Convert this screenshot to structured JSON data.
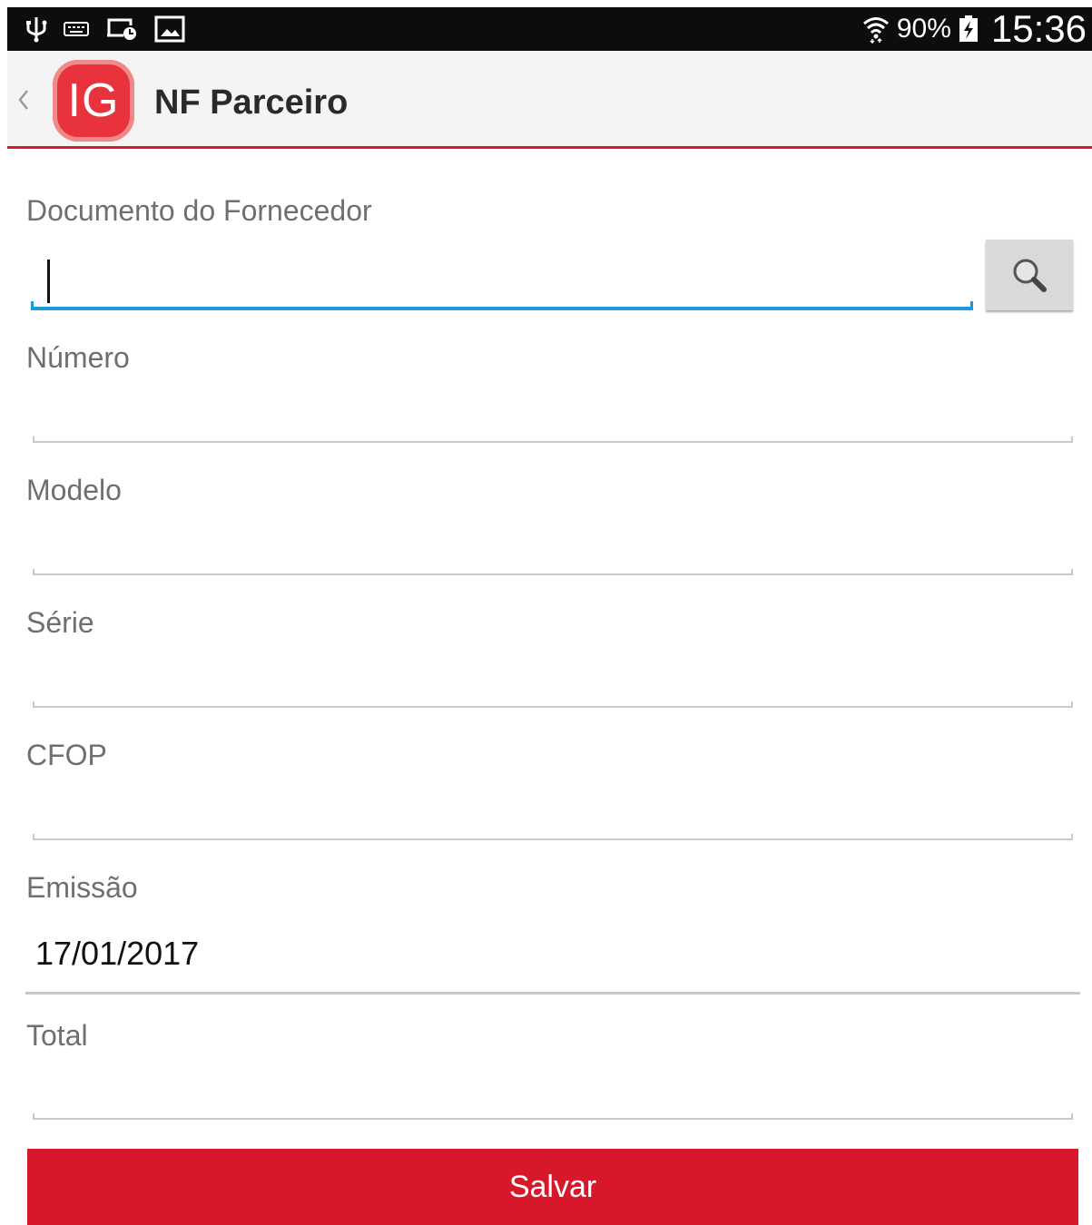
{
  "status_bar": {
    "icons_left": [
      "usb-icon",
      "keyboard-icon",
      "cast-screen-icon",
      "gallery-icon"
    ],
    "icons_right": [
      "wifi-icon",
      "battery-charging-icon"
    ],
    "battery_text": "90%",
    "time": "15:36"
  },
  "app_bar": {
    "logo_text": "IG",
    "title": "NF Parceiro",
    "accent_color": "#d7182a"
  },
  "form": {
    "fields": [
      {
        "label": "Documento do Fornecedor",
        "value": ""
      },
      {
        "label": "Número",
        "value": ""
      },
      {
        "label": "Modelo",
        "value": ""
      },
      {
        "label": "Série",
        "value": ""
      },
      {
        "label": "CFOP",
        "value": ""
      },
      {
        "label": "Emissão",
        "value": "17/01/2017"
      },
      {
        "label": "Total",
        "value": ""
      }
    ],
    "search_icon": "search-icon",
    "focus_color": "#1a9ad6"
  },
  "actions": {
    "save_label": "Salvar"
  }
}
